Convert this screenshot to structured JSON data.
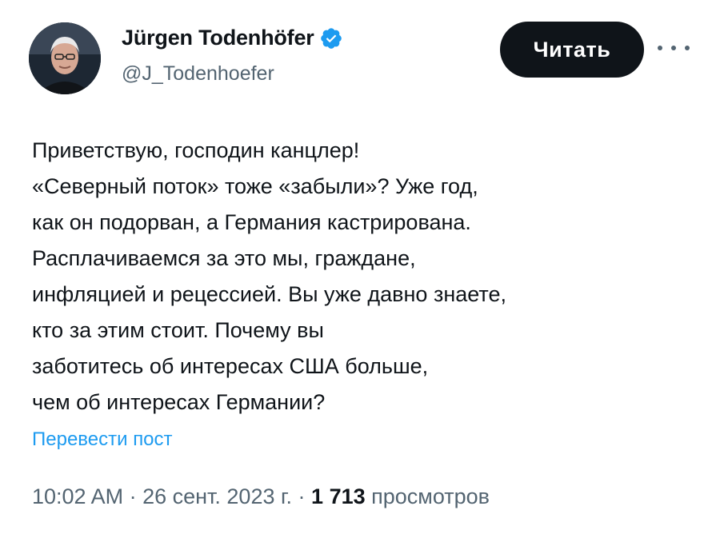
{
  "author": {
    "display_name": "Jürgen Todenhöfer",
    "handle": "@J_Todenhoefer",
    "verified_icon": "verified-badge-icon",
    "verified_color": "#1d9bf0"
  },
  "actions": {
    "follow_label": "Читать",
    "more_icon": "more-horizontal-icon"
  },
  "tweet": {
    "lines": [
      "Приветствую, господин канцлер!",
      "«Северный поток» тоже «забыли»? Уже год,",
      "как он подорван, а Германия кастрирована.",
      "Расплачиваемся за это мы, граждане,",
      "инфляцией и рецессией. Вы уже давно знаете,",
      "кто за этим стоит. Почему вы",
      "заботитесь об интересах США больше,",
      "чем об интересах Германии?"
    ],
    "translate_label": "Перевести пост"
  },
  "meta": {
    "time": "10:02 AM",
    "separator": " · ",
    "date": "26 сент. 2023 г.",
    "views_count": "1 713",
    "views_label": "просмотров"
  },
  "colors": {
    "text": "#0f1419",
    "secondary": "#536471",
    "link": "#1d9bf0",
    "button_bg": "#0f1419"
  }
}
